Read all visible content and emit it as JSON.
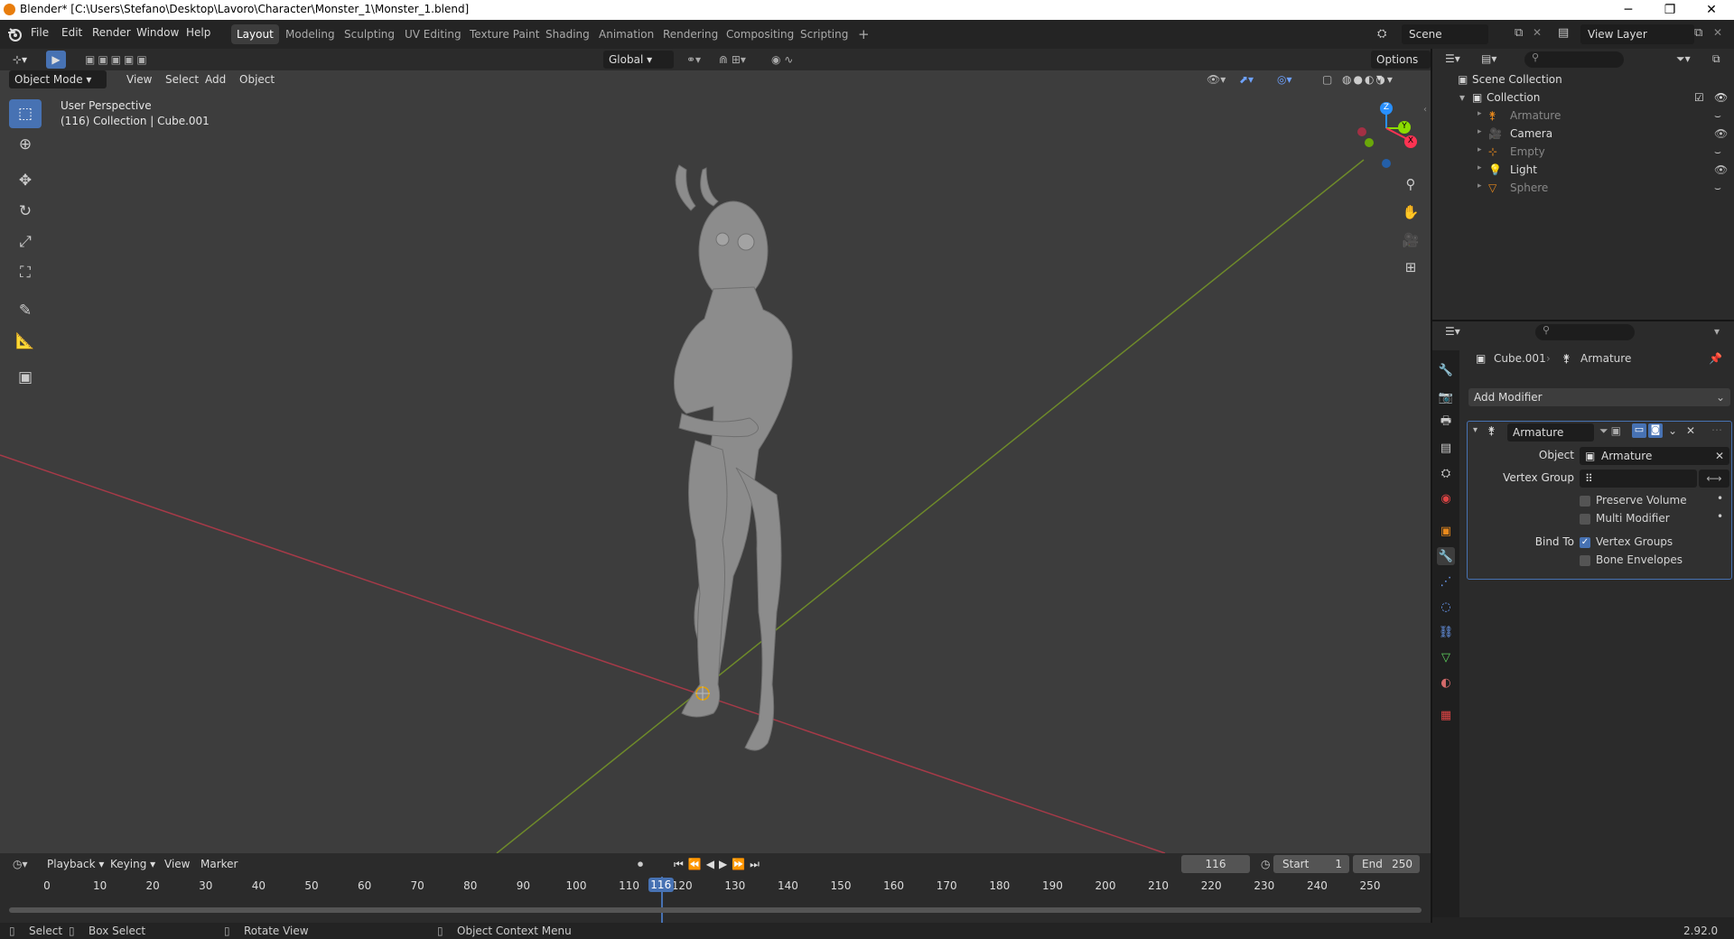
{
  "window": {
    "title": "Blender* [C:\\Users\\Stefano\\Desktop\\Lavoro\\Character\\Monster_1\\Monster_1.blend]",
    "minimize": "─",
    "maximize": "❐",
    "close": "✕"
  },
  "menubar": {
    "menus": [
      "File",
      "Edit",
      "Render",
      "Window",
      "Help"
    ],
    "workspaces": [
      "Layout",
      "Modeling",
      "Sculpting",
      "UV Editing",
      "Texture Paint",
      "Shading",
      "Animation",
      "Rendering",
      "Compositing",
      "Scripting"
    ],
    "active_workspace": "Layout",
    "add_workspace": "+",
    "scene": "Scene",
    "view_layer": "View Layer"
  },
  "viewport_header": {
    "transform_orientation": "Global",
    "options": "Options",
    "mode": "Object Mode",
    "menus": [
      "View",
      "Select",
      "Add",
      "Object"
    ]
  },
  "viewport": {
    "perspective": "User Perspective",
    "context": "(116) Collection | Cube.001",
    "gizmo_axes": [
      "Z",
      "Y",
      "X"
    ],
    "axis_colors": {
      "x": "#ff3352",
      "y": "#8bdc00",
      "z": "#2890ff"
    },
    "tools": [
      "select-box",
      "cursor",
      "move",
      "rotate",
      "scale",
      "transform",
      "annotate",
      "measure",
      "add-cube"
    ],
    "nav_icons": [
      "zoom-icon",
      "hand-icon",
      "camera-icon",
      "grid-icon"
    ]
  },
  "outliner": {
    "root": "Scene Collection",
    "collection": "Collection",
    "items": [
      {
        "name": "Armature",
        "icon": "armature-icon",
        "visible": false,
        "color": "#888888"
      },
      {
        "name": "Camera",
        "icon": "camera-icon",
        "visible": true,
        "color": "#dddddd"
      },
      {
        "name": "Empty",
        "icon": "empty-icon",
        "visible": false,
        "color": "#888888"
      },
      {
        "name": "Light",
        "icon": "light-icon",
        "visible": true,
        "color": "#dddddd"
      },
      {
        "name": "Sphere",
        "icon": "mesh-icon",
        "visible": false,
        "color": "#888888"
      }
    ]
  },
  "properties": {
    "object_name": "Cube.001",
    "modifier_target": "Armature",
    "add_modifier": "Add Modifier",
    "modifier": {
      "name": "Armature",
      "object_label": "Object",
      "object_value": "Armature",
      "vertex_group_label": "Vertex Group",
      "vertex_group_value": "",
      "options": [
        {
          "label": "Preserve Volume",
          "checked": false
        },
        {
          "label": "Multi Modifier",
          "checked": false
        }
      ],
      "bind_to_label": "Bind To",
      "bind_options": [
        {
          "label": "Vertex Groups",
          "checked": true
        },
        {
          "label": "Bone Envelopes",
          "checked": false
        }
      ]
    }
  },
  "timeline": {
    "menus": [
      "Playback",
      "Keying",
      "View",
      "Marker"
    ],
    "current_frame": "116",
    "start_label": "Start",
    "start": "1",
    "end_label": "End",
    "end": "250",
    "ticks": [
      "0",
      "10",
      "20",
      "30",
      "40",
      "50",
      "60",
      "70",
      "80",
      "90",
      "100",
      "110",
      "120",
      "130",
      "140",
      "150",
      "160",
      "170",
      "180",
      "190",
      "200",
      "210",
      "220",
      "230",
      "240",
      "250"
    ],
    "playhead": "116"
  },
  "statusbar": {
    "select": "Select",
    "box_select": "Box Select",
    "rotate_view": "Rotate View",
    "context_menu": "Object Context Menu",
    "version": "2.92.0"
  }
}
